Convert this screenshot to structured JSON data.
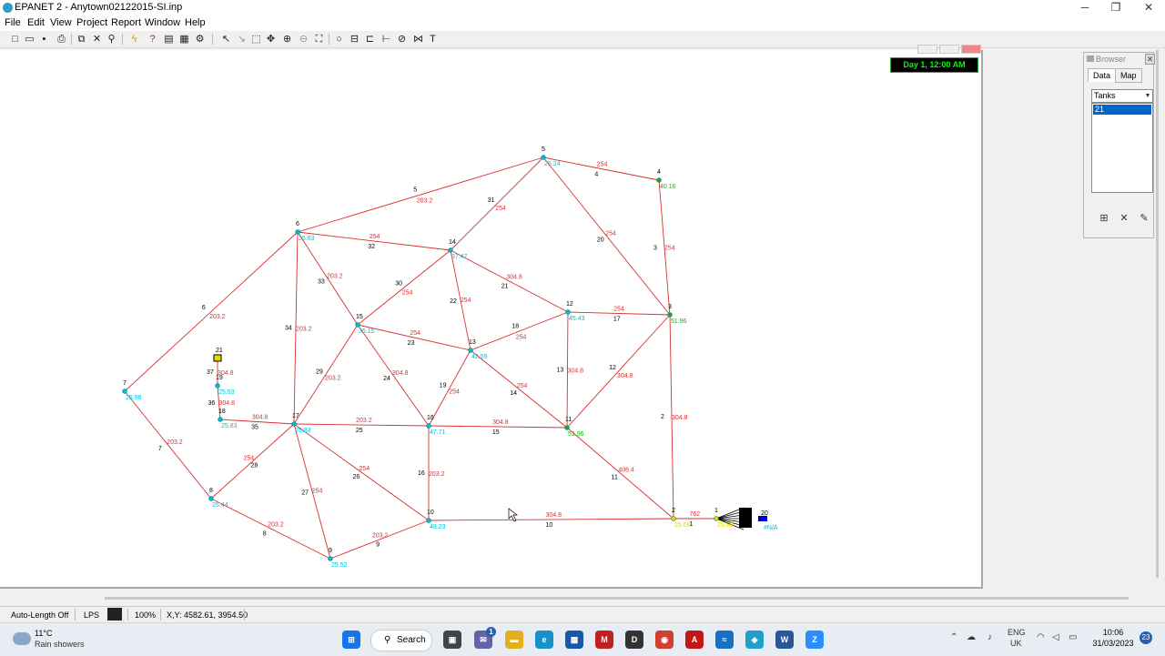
{
  "window": {
    "title": "EPANET 2 - Anytown02122015-SI.inp"
  },
  "menu": [
    "File",
    "Edit",
    "View",
    "Project",
    "Report",
    "Window",
    "Help"
  ],
  "map": {
    "time_label": "Day 1, 12:00 AM",
    "colors": {
      "pipe": "#d83030",
      "node_default": "#008080",
      "node_value": "#00bcd4",
      "node_green": "#22aa22",
      "node_yellow": "#e8d800",
      "label": "#000000"
    },
    "junctions": [
      {
        "id": "5",
        "value": "25.24",
        "color": "node_value"
      },
      {
        "id": "4",
        "value": "40.16",
        "color": "node_green"
      },
      {
        "id": "6",
        "value": "25.63",
        "color": "node_value"
      },
      {
        "id": "14",
        "value": "37.47",
        "color": "node_value"
      },
      {
        "id": "12",
        "value": "45.43",
        "color": "node_value"
      },
      {
        "id": "3",
        "value": "51.96",
        "color": "node_green"
      },
      {
        "id": "15",
        "value": "35.15",
        "color": "node_value"
      },
      {
        "id": "13",
        "value": "42.59",
        "color": "node_value"
      },
      {
        "id": "7",
        "value": "25.96",
        "color": "node_value"
      },
      {
        "id": "21",
        "value": "",
        "color": "node_yellow"
      },
      {
        "id": "19",
        "value": "25.53",
        "color": "node_value"
      },
      {
        "id": "18",
        "value": "25.83",
        "color": "node_value"
      },
      {
        "id": "17",
        "value": "25.83",
        "color": "node_value"
      },
      {
        "id": "16",
        "value": "47.71",
        "color": "node_value"
      },
      {
        "id": "11",
        "value": "51.96",
        "color": "node_green"
      },
      {
        "id": "8",
        "value": "25.44",
        "color": "node_value"
      },
      {
        "id": "10",
        "value": "48.23",
        "color": "node_value"
      },
      {
        "id": "9",
        "value": "25.52",
        "color": "node_value"
      },
      {
        "id": "2",
        "value": "25.68",
        "color": "node_yellow"
      },
      {
        "id": "1",
        "value": "25.68",
        "color": "node_yellow"
      },
      {
        "id": "20",
        "value": "#N/A",
        "color": "node_value"
      }
    ],
    "pipes": [
      {
        "id": "4",
        "value": "254"
      },
      {
        "id": "5",
        "value": "203.2"
      },
      {
        "id": "31",
        "value": "254"
      },
      {
        "id": "32",
        "value": "254"
      },
      {
        "id": "20",
        "value": "254"
      },
      {
        "id": "3",
        "value": "254"
      },
      {
        "id": "21",
        "value": "304.8"
      },
      {
        "id": "22",
        "value": "254"
      },
      {
        "id": "33",
        "value": "203.2"
      },
      {
        "id": "30",
        "value": "254"
      },
      {
        "id": "6",
        "value": "203.2"
      },
      {
        "id": "34",
        "value": "203.2"
      },
      {
        "id": "17",
        "value": "254"
      },
      {
        "id": "18",
        "value": "254"
      },
      {
        "id": "23",
        "value": "254"
      },
      {
        "id": "12",
        "value": "304.8"
      },
      {
        "id": "13",
        "value": "304.8"
      },
      {
        "id": "14",
        "value": "254"
      },
      {
        "id": "29",
        "value": "203.2"
      },
      {
        "id": "24",
        "value": "304.8"
      },
      {
        "id": "19",
        "value": "254"
      },
      {
        "id": "2",
        "value": "304.8"
      },
      {
        "id": "35",
        "value": "304.8"
      },
      {
        "id": "25",
        "value": "203.2"
      },
      {
        "id": "15",
        "value": "304.8"
      },
      {
        "id": "7",
        "value": "203.2"
      },
      {
        "id": "28",
        "value": "254"
      },
      {
        "id": "26",
        "value": "254"
      },
      {
        "id": "16",
        "value": "203.2"
      },
      {
        "id": "11",
        "value": "406.4"
      },
      {
        "id": "27",
        "value": "254"
      },
      {
        "id": "10",
        "value": "304.8"
      },
      {
        "id": "1",
        "value": "762"
      },
      {
        "id": "8",
        "value": "203.2"
      },
      {
        "id": "9",
        "value": "203.2"
      },
      {
        "id": "36",
        "value": "304.8"
      },
      {
        "id": "37",
        "value": "304.8"
      }
    ]
  },
  "browser": {
    "title": "Browser",
    "tabs": [
      "Data",
      "Map"
    ],
    "category": "Tanks",
    "items": [
      "21"
    ]
  },
  "status": {
    "auto_length": "Auto-Length Off",
    "units": "LPS",
    "zoom": "100%",
    "xy": "X,Y: 4582.61, 3954.50"
  },
  "taskbar": {
    "weather_temp": "11°C",
    "weather_cond": "Rain showers",
    "search_label": "Search",
    "lang": "ENG",
    "region": "UK",
    "time": "10:06",
    "date": "31/03/2023",
    "notifications": "23",
    "badge": "1"
  }
}
